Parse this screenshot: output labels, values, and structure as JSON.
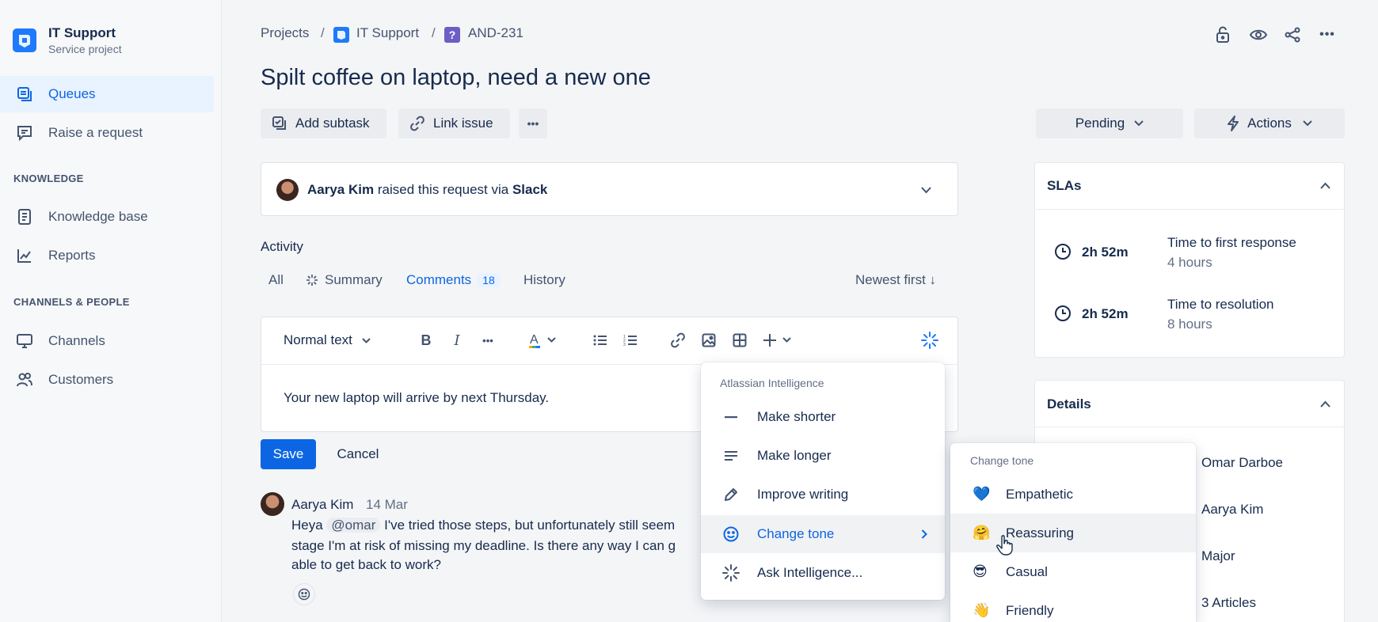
{
  "sidebar": {
    "project_title": "IT Support",
    "project_subtitle": "Service project",
    "items": [
      {
        "label": "Queues"
      },
      {
        "label": "Raise a request"
      },
      {
        "label": "Knowledge base"
      },
      {
        "label": "Reports"
      },
      {
        "label": "Channels"
      },
      {
        "label": "Customers"
      }
    ],
    "sections": {
      "knowledge": "KNOWLEDGE",
      "channels": "CHANNELS & PEOPLE"
    }
  },
  "breadcrumb": {
    "projects": "Projects",
    "project": "IT Support",
    "issue": "AND-231",
    "sep": "/"
  },
  "issue": {
    "title": "Spilt coffee on laptop, need a new one"
  },
  "actions": {
    "add_subtask": "Add subtask",
    "link_issue": "Link issue",
    "more": "•••"
  },
  "status": {
    "pending": "Pending",
    "actions": "Actions"
  },
  "request": {
    "requester": "Aarya Kim",
    "raised_text": "raised this request via",
    "channel": "Slack"
  },
  "activity": {
    "heading": "Activity",
    "tabs": {
      "all": "All",
      "summary": "Summary",
      "comments": "Comments",
      "comments_count": "18",
      "history": "History"
    },
    "sort": "Newest first ↓"
  },
  "editor": {
    "text_style": "Normal text",
    "content": "Your new laptop will arrive by next Thursday.",
    "save": "Save",
    "cancel": "Cancel"
  },
  "comment": {
    "author": "Aarya Kim",
    "date": "14 Mar",
    "mention": "@omar",
    "line1": "I've tried those steps, but unfortunately still seem",
    "line1_prefix": "Heya",
    "line2": "stage I'm at risk of missing my deadline. Is there any way I can g",
    "line3": "able to get back to work?"
  },
  "ai_menu": {
    "header": "Atlassian Intelligence",
    "items": [
      {
        "label": "Make shorter",
        "icon": "minus-icon"
      },
      {
        "label": "Make longer",
        "icon": "lines-icon"
      },
      {
        "label": "Improve writing",
        "icon": "pencil-icon"
      },
      {
        "label": "Change tone",
        "icon": "smiley-icon"
      },
      {
        "label": "Ask Intelligence...",
        "icon": "sparkle-icon"
      }
    ]
  },
  "tone_menu": {
    "header": "Change tone",
    "items": [
      {
        "label": "Empathetic",
        "emoji": "💙"
      },
      {
        "label": "Reassuring",
        "emoji": "🤗"
      },
      {
        "label": "Casual",
        "emoji": "😎"
      },
      {
        "label": "Friendly",
        "emoji": "👋"
      }
    ]
  },
  "slas": {
    "heading": "SLAs",
    "items": [
      {
        "time": "2h 52m",
        "name": "Time to first response",
        "target": "4 hours"
      },
      {
        "time": "2h 52m",
        "name": "Time to resolution",
        "target": "8 hours"
      }
    ]
  },
  "details": {
    "heading": "Details",
    "values": [
      "Omar Darboe",
      "Aarya Kim",
      "Major",
      "3 Articles"
    ]
  },
  "colors": {
    "accent": "#0c66e4",
    "primary_button": "#0c66e4"
  }
}
